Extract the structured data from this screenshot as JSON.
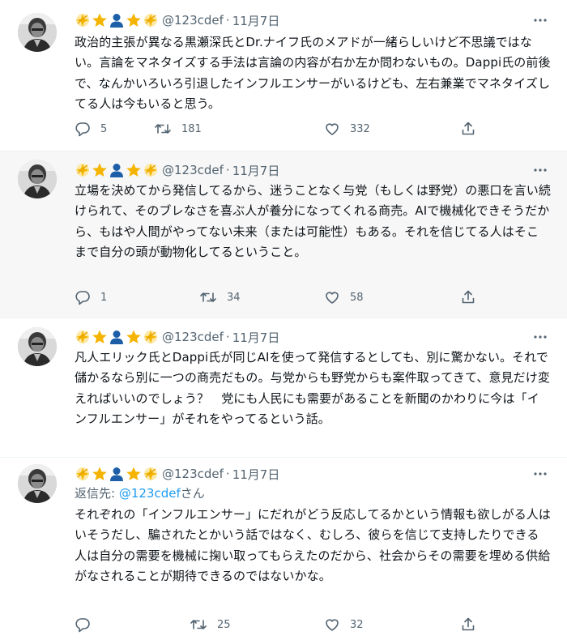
{
  "tweets": [
    {
      "handle": "@123cdef",
      "dot": "·",
      "date": "11月7日",
      "text": "政治的主張が異なる黒瀬深氏とDr.ナイフ氏のメアドが一緒らしいけど不思議ではない。言論をマネタイズする手法は言論の内容が右か左か問わないもの。Dappi氏の前後で、なんかいろいろ引退したインフルエンサーがいるけども、左右兼業でマネタイズしてる人は今もいると思う。",
      "replies": "5",
      "retweets": "181",
      "likes": "332"
    },
    {
      "handle": "@123cdef",
      "dot": "·",
      "date": "11月7日",
      "text": "立場を決めてから発信してるから、迷うことなく与党（もしくは野党）の悪口を言い続けられて、そのブレなさを喜ぶ人が養分になってくれる商売。AIで機械化できそうだから、もはや人間がやってない未来（または可能性）もある。それを信じてる人はそこまで自分の頭が動物化してるということ。",
      "replies": "1",
      "retweets": "34",
      "likes": "58"
    },
    {
      "handle": "@123cdef",
      "dot": "·",
      "date": "11月7日",
      "text": "凡人エリック氏とDappi氏が同じAIを使って発信するとしても、別に驚かない。それで儲かるなら別に一つの商売だもの。与党からも野党からも案件取ってきて、意見だけ変えればいいのでしょう？　党にも人民にも需要があることを新聞のかわりに今は「インフルエンサー」がそれをやってるという話。"
    },
    {
      "handle": "@123cdef",
      "dot": "·",
      "date": "11月7日",
      "reply_prefix": "返信先: ",
      "reply_handle": "@123cdef",
      "reply_suffix": "さん",
      "text": "それぞれの「インフルエンサー」にだれがどう反応してるかという情報も欲しがる人はいそうだし、騙されたとかいう話ではなく、むしろ、彼らを信じて支持したりできる人は自分の需要を機械に掬い取ってもらえたのだから、社会からその需要を埋める供給がなされることが期待できるのではないかな。",
      "retweets": "25",
      "likes": "32"
    }
  ],
  "icons": [
    "sparkle-icon",
    "star-icon",
    "person-icon",
    "star-icon",
    "sparkle-icon",
    "more-icon",
    "reply-icon",
    "retweet-icon",
    "like-icon",
    "share-icon"
  ],
  "colors": {
    "secondary_text": "#536471",
    "link": "#1d9bf0",
    "star": "#f4b400",
    "person": "#1c5ea8",
    "highlight_bg": "#f7f7f7"
  }
}
